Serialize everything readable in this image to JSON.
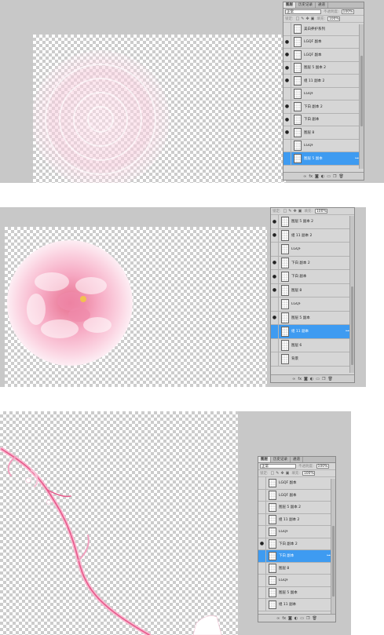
{
  "panel_a": {
    "tabs": [
      {
        "label": "图层",
        "active": true
      },
      {
        "label": "历史记录",
        "active": false
      },
      {
        "label": "通道",
        "active": false
      }
    ],
    "blend_mode": "正常",
    "opacity_label": "不透明度:",
    "opacity_value": "100%",
    "lock_label": "锁定:",
    "fill_label": "填充:",
    "fill_value": "100%",
    "layers": [
      {
        "name": "美白养护系列",
        "visible": false,
        "selected": false
      },
      {
        "name": "LGQF 副本",
        "visible": true,
        "selected": false
      },
      {
        "name": "LGQF 副本",
        "visible": true,
        "selected": false
      },
      {
        "name": "图层 5 副本 2",
        "visible": true,
        "selected": false
      },
      {
        "name": "组 11 副本 2",
        "visible": true,
        "selected": false
      },
      {
        "name": "LGQF",
        "visible": false,
        "selected": false
      },
      {
        "name": "下白 副本 2",
        "visible": true,
        "selected": false
      },
      {
        "name": "下白 副本",
        "visible": true,
        "selected": false
      },
      {
        "name": "图层 8",
        "visible": true,
        "selected": false
      },
      {
        "name": "LGQF",
        "visible": false,
        "selected": false
      },
      {
        "name": "图层 5 副本",
        "visible": false,
        "selected": true
      }
    ]
  },
  "panel_b": {
    "blend_mode": "正常",
    "lock_label": "锁定:",
    "fill_label": "填充:",
    "fill_value": "100%",
    "layers": [
      {
        "name": "图层 5 副本 2",
        "visible": true,
        "selected": false
      },
      {
        "name": "组 11 副本 2",
        "visible": true,
        "selected": false
      },
      {
        "name": "LGQF",
        "visible": false,
        "selected": false
      },
      {
        "name": "下白 副本 2",
        "visible": true,
        "selected": false
      },
      {
        "name": "下白 副本",
        "visible": true,
        "selected": false
      },
      {
        "name": "图层 8",
        "visible": true,
        "selected": false
      },
      {
        "name": "LGQF",
        "visible": false,
        "selected": false
      },
      {
        "name": "图层 5 副本",
        "visible": true,
        "selected": false
      },
      {
        "name": "组 11 副本",
        "visible": false,
        "selected": true
      },
      {
        "name": "图层 6",
        "visible": false,
        "selected": false
      },
      {
        "name": "背景",
        "visible": false,
        "selected": false
      }
    ]
  },
  "panel_c": {
    "tabs": [
      {
        "label": "图层",
        "active": true
      },
      {
        "label": "历史记录",
        "active": false
      },
      {
        "label": "通道",
        "active": false
      }
    ],
    "blend_mode": "正常",
    "opacity_label": "不透明度:",
    "opacity_value": "100%",
    "lock_label": "锁定:",
    "fill_label": "填充:",
    "fill_value": "100%",
    "layers": [
      {
        "name": "LGQF 副本",
        "visible": false,
        "selected": false
      },
      {
        "name": "LGQF 副本",
        "visible": false,
        "selected": false
      },
      {
        "name": "图层 5 副本 2",
        "visible": false,
        "selected": false
      },
      {
        "name": "组 11 副本 2",
        "visible": false,
        "selected": false
      },
      {
        "name": "LGQF",
        "visible": false,
        "selected": false
      },
      {
        "name": "下白 副本 2",
        "visible": true,
        "selected": false
      },
      {
        "name": "下白 副本",
        "visible": false,
        "selected": true
      },
      {
        "name": "图层 8",
        "visible": false,
        "selected": false
      },
      {
        "name": "LGQF",
        "visible": false,
        "selected": false
      },
      {
        "name": "图层 5 副本",
        "visible": false,
        "selected": false
      },
      {
        "name": "组 11 副本",
        "visible": false,
        "selected": false
      }
    ]
  },
  "colors": {
    "selected_row": "#3e9bf1",
    "peony": "#f4a9c4",
    "gray_bg": "#c8c8c8"
  },
  "icons": {
    "eye": "eye-icon",
    "link": "link-icon",
    "bottom_bar": [
      "link-layers-icon",
      "fx-icon",
      "mask-icon",
      "adjustment-icon",
      "folder-icon",
      "new-layer-icon",
      "trash-icon"
    ]
  }
}
